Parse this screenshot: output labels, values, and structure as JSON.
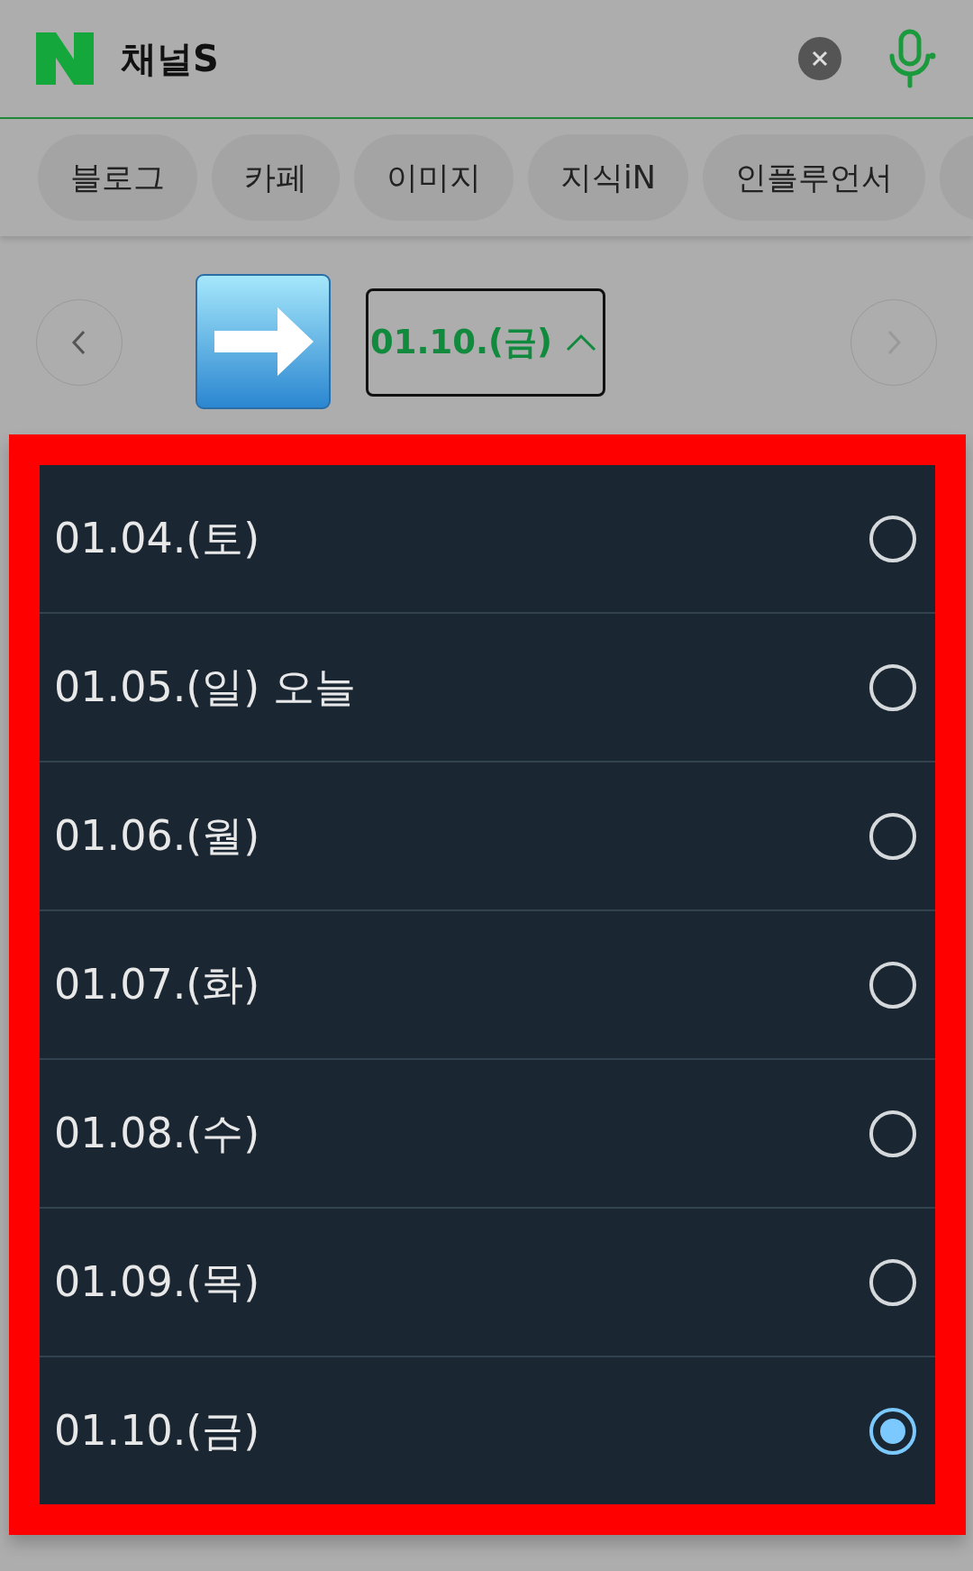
{
  "search": {
    "value": "채널S"
  },
  "tabs": [
    {
      "label": "블로그",
      "selected": false
    },
    {
      "label": "카페",
      "selected": false
    },
    {
      "label": "이미지",
      "selected": false
    },
    {
      "label": "지식iN",
      "selected": false
    },
    {
      "label": "인플루언서",
      "selected": false
    }
  ],
  "date_nav": {
    "current": "01.10.(금)",
    "expanded": true
  },
  "date_options": [
    {
      "label": "01.04.(토)",
      "selected": false
    },
    {
      "label": "01.05.(일) 오늘",
      "selected": false
    },
    {
      "label": "01.06.(월)",
      "selected": false
    },
    {
      "label": "01.07.(화)",
      "selected": false
    },
    {
      "label": "01.08.(수)",
      "selected": false
    },
    {
      "label": "01.09.(목)",
      "selected": false
    },
    {
      "label": "01.10.(금)",
      "selected": true
    }
  ]
}
